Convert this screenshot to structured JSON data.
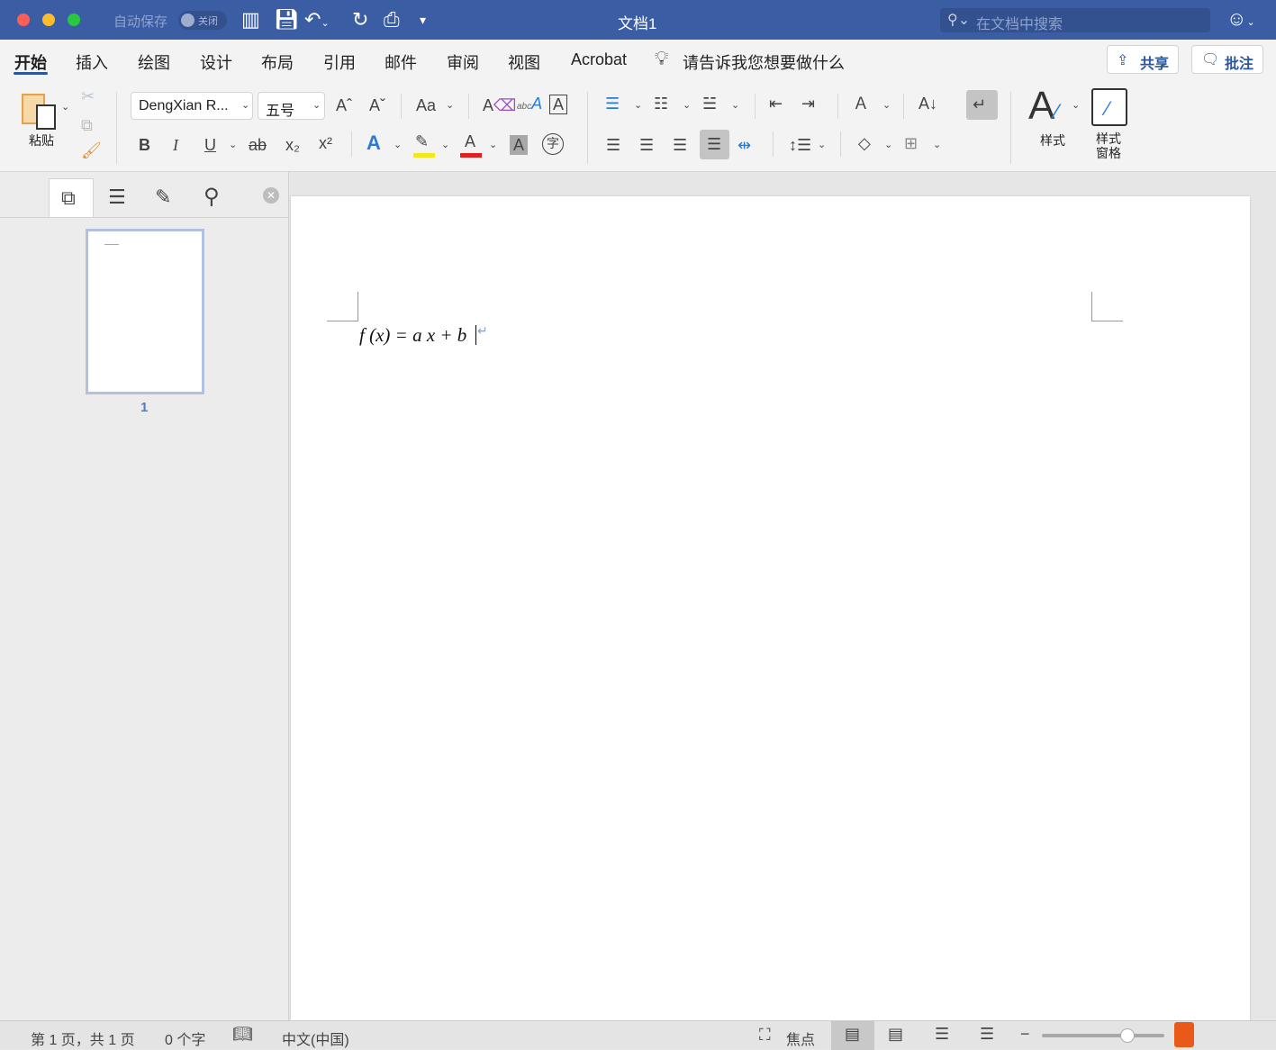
{
  "window": {
    "title": "文档1",
    "autosave_label": "自动保存",
    "autosave_state": "关闭",
    "search_placeholder": "在文档中搜索"
  },
  "tabs": [
    "开始",
    "插入",
    "绘图",
    "设计",
    "布局",
    "引用",
    "邮件",
    "审阅",
    "视图",
    "Acrobat"
  ],
  "active_tab": "开始",
  "tell_me": "请告诉我您想要做什么",
  "share_label": "共享",
  "comments_label": "批注",
  "ribbon": {
    "paste_label": "粘贴",
    "font_name": "DengXian R...",
    "font_size": "五号",
    "change_case": "Aa",
    "styles_label": "样式",
    "styles_pane_label": "样式\n窗格",
    "styles_pane_line1": "样式",
    "styles_pane_line2": "窗格",
    "bold": "B",
    "italic": "I",
    "underline": "U",
    "strike": "ab",
    "subscript": "x₂",
    "superscript": "x²"
  },
  "colors": {
    "titlebar": "#3a5da3",
    "accent": "#2b579a",
    "highlight": "#f5e61c",
    "font_color": "#e02020"
  },
  "sidebar": {
    "page_thumb_label": "1"
  },
  "document": {
    "equation": "f (x) = a x + b"
  },
  "status": {
    "page": "第 1 页，共 1 页",
    "words": "0 个字",
    "language": "中文(中国)",
    "focus": "焦点",
    "zoom_level": 0.7
  }
}
